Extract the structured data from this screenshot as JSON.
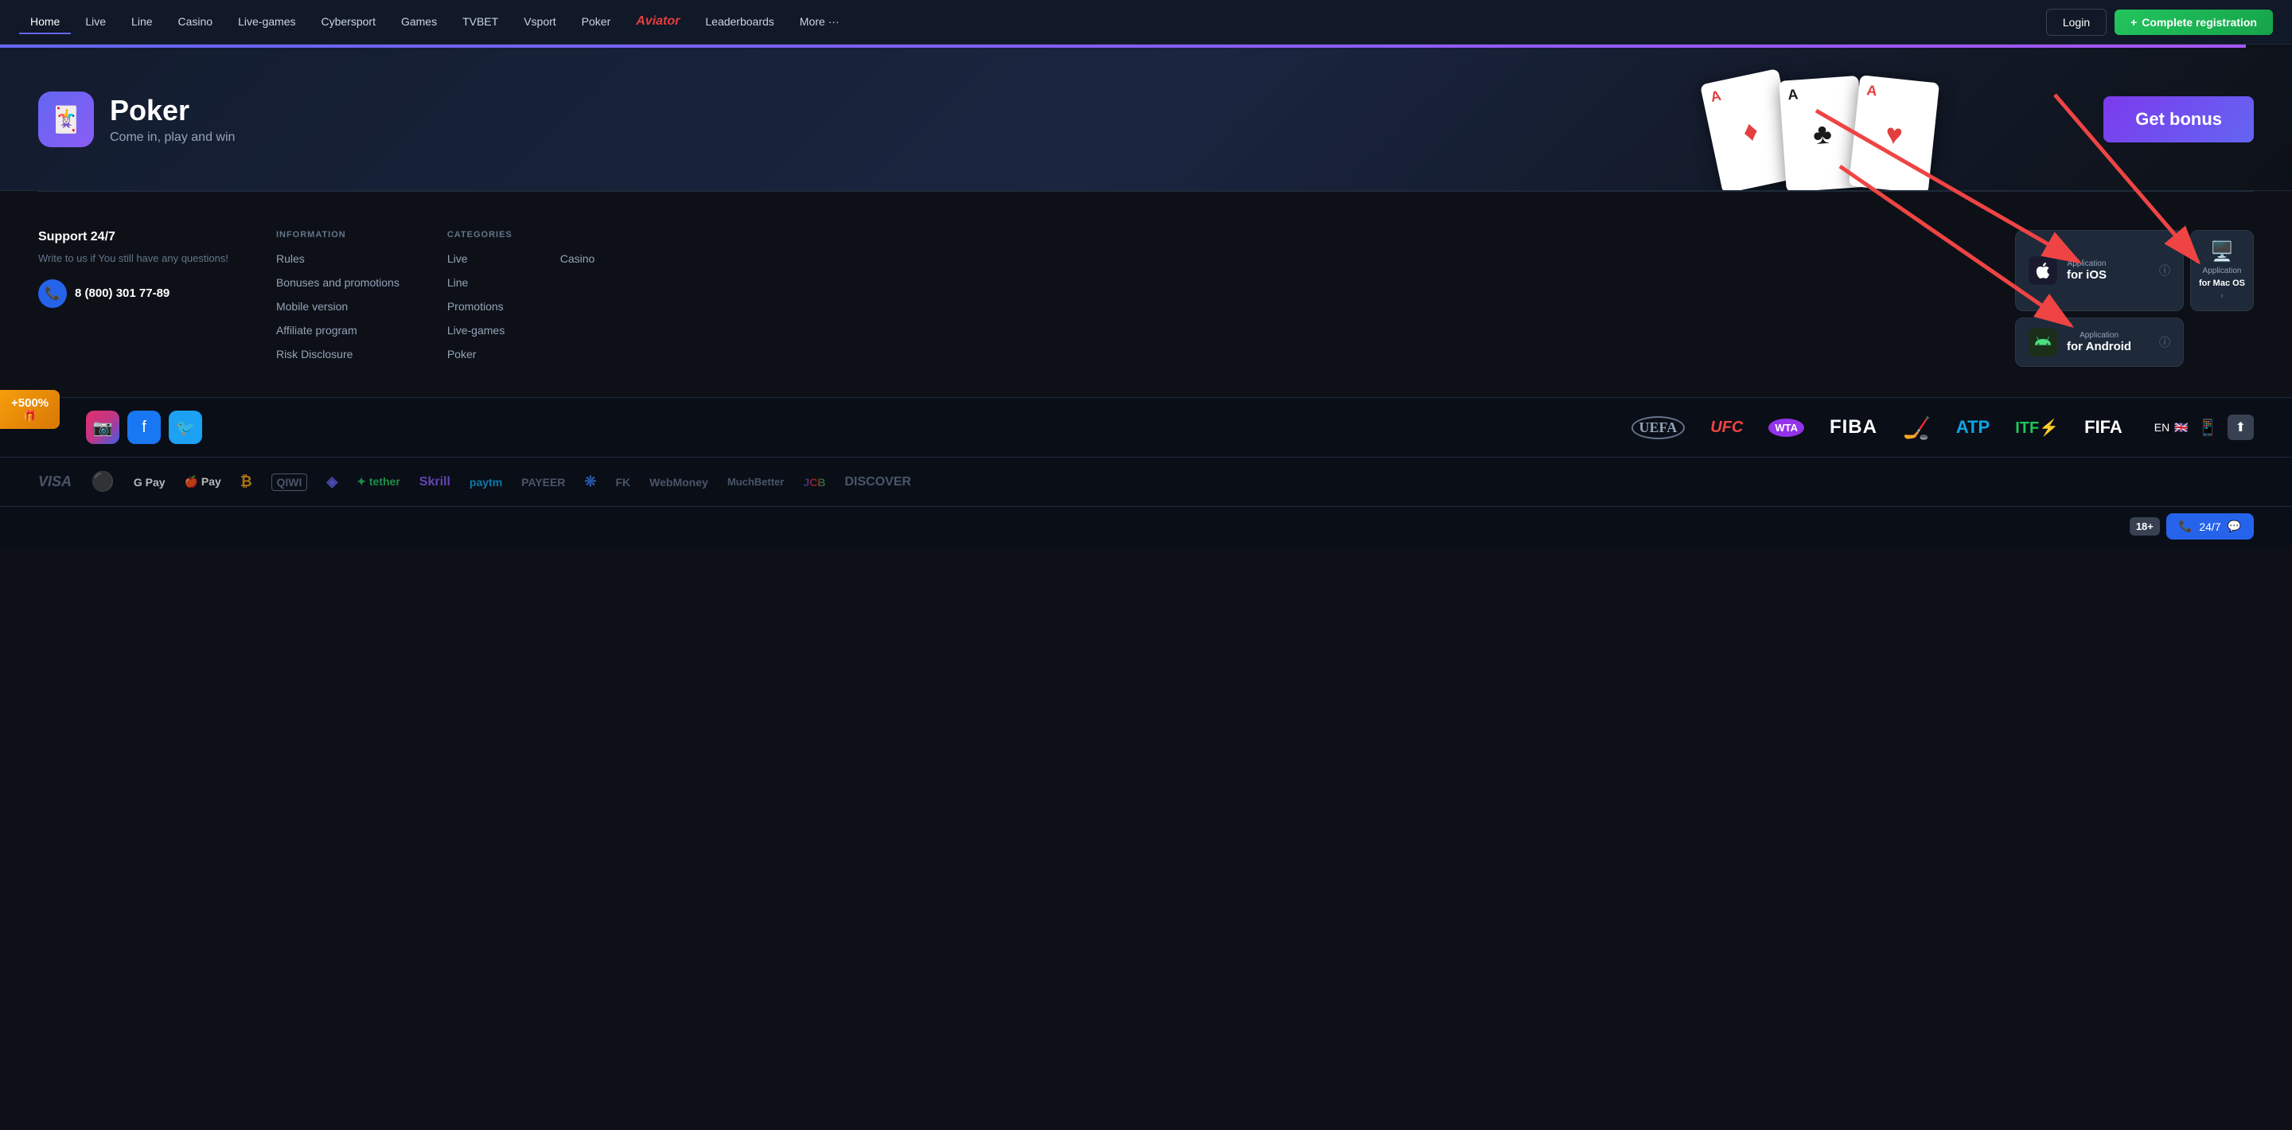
{
  "nav": {
    "links": [
      {
        "label": "Home",
        "active": true
      },
      {
        "label": "Live",
        "active": false
      },
      {
        "label": "Line",
        "active": false
      },
      {
        "label": "Casino",
        "active": false
      },
      {
        "label": "Live-games",
        "active": false
      },
      {
        "label": "Cybersport",
        "active": false
      },
      {
        "label": "Games",
        "active": false
      },
      {
        "label": "TVBET",
        "active": false
      },
      {
        "label": "Vsport",
        "active": false
      },
      {
        "label": "Poker",
        "active": false
      },
      {
        "label": "Aviator",
        "active": false,
        "special": "aviator"
      },
      {
        "label": "Leaderboards",
        "active": false
      },
      {
        "label": "More ···",
        "active": false
      }
    ],
    "login_label": "Login",
    "register_label": "Complete registration",
    "register_plus": "+"
  },
  "poker_banner": {
    "title": "Poker",
    "subtitle": "Come in, play and win",
    "bonus_btn": "Get bonus",
    "cards": [
      {
        "rank": "A",
        "suit": "♦",
        "suit_type": "diamonds"
      },
      {
        "rank": "A",
        "suit": "♣",
        "suit_type": "clubs"
      },
      {
        "rank": "A",
        "suit": "♥",
        "suit_type": "hearts"
      }
    ]
  },
  "footer": {
    "support": {
      "heading": "Support 24/7",
      "description": "Write to us if You still have any questions!",
      "phone": "8 (800) 301 77-89"
    },
    "information": {
      "heading": "INFORMATION",
      "links": [
        "Rules",
        "Bonuses and promotions",
        "Mobile version",
        "Affiliate program",
        "Risk Disclosure"
      ]
    },
    "categories": {
      "heading": "CATEGORIES",
      "links": [
        "Live",
        "Line",
        "Promotions",
        "Live-games",
        "Poker"
      ]
    },
    "categories2": {
      "links": [
        "Casino"
      ]
    },
    "apps": {
      "ios_label_small": "Application",
      "ios_label": "for iOS",
      "android_label_small": "Application",
      "android_label": "for Android",
      "macos_label_small": "Application",
      "macos_label": "for Mac OS"
    }
  },
  "social": {
    "bonus_pct": "+500%",
    "bonus_icon": "🎁"
  },
  "sports_logos": [
    "UEFA",
    "UFC",
    "WTA",
    "FIBA",
    "🏒",
    "ATP",
    "ITF⚡",
    "FIFA"
  ],
  "payment_logos": [
    "VISA",
    "●",
    "G Pay",
    "Apple Pay",
    "₿",
    "QIWI",
    "◈",
    "tether",
    "Skrill",
    "paytm",
    "PAYEER",
    "❊",
    "FK",
    "WebMoney",
    "MuchBetter",
    "JCB",
    "DISCOVER"
  ],
  "lang": {
    "code": "EN",
    "flag": "🇬🇧"
  },
  "age": {
    "badge": "18+",
    "support_label": "24/7"
  }
}
